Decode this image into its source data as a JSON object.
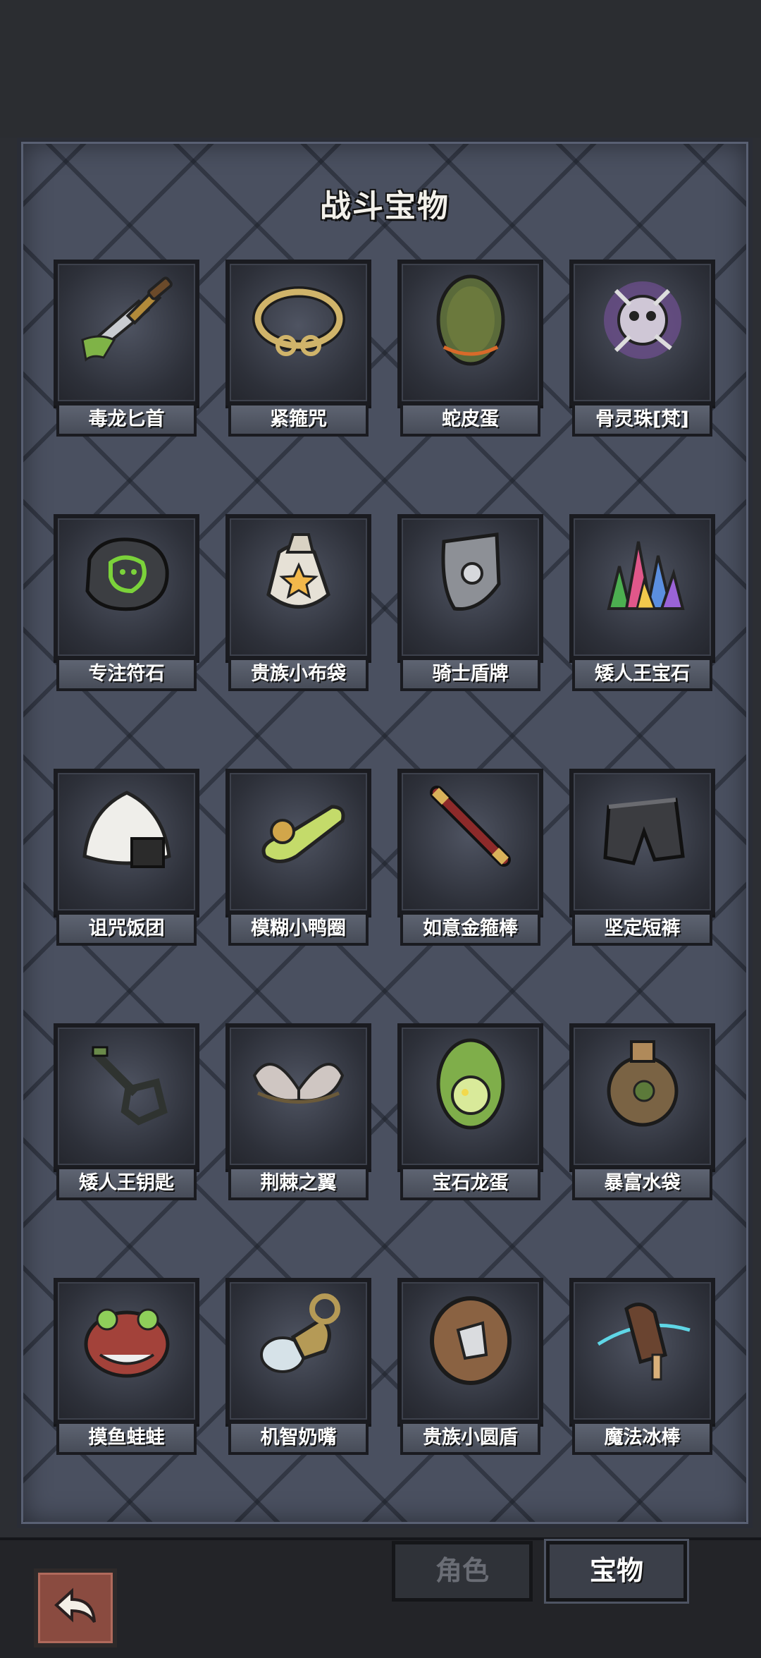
{
  "title": "战斗宝物",
  "items": [
    {
      "label": "毒龙匕首",
      "icon": "poison-dagger-icon"
    },
    {
      "label": "紧箍咒",
      "icon": "golden-band-icon"
    },
    {
      "label": "蛇皮蛋",
      "icon": "snakeskin-egg-icon"
    },
    {
      "label": "骨灵珠[梵]",
      "icon": "bone-orb-icon"
    },
    {
      "label": "专注符石",
      "icon": "focus-rune-icon"
    },
    {
      "label": "贵族小布袋",
      "icon": "cloth-bag-icon"
    },
    {
      "label": "骑士盾牌",
      "icon": "knight-shield-icon"
    },
    {
      "label": "矮人王宝石",
      "icon": "dwarf-gems-icon"
    },
    {
      "label": "诅咒饭团",
      "icon": "rice-ball-icon"
    },
    {
      "label": "模糊小鸭圈",
      "icon": "duck-ring-icon"
    },
    {
      "label": "如意金箍棒",
      "icon": "staff-icon"
    },
    {
      "label": "坚定短裤",
      "icon": "shorts-icon"
    },
    {
      "label": "矮人王钥匙",
      "icon": "key-icon"
    },
    {
      "label": "荆棘之翼",
      "icon": "thorn-wings-icon"
    },
    {
      "label": "宝石龙蛋",
      "icon": "dragon-egg-icon"
    },
    {
      "label": "暴富水袋",
      "icon": "water-flask-icon"
    },
    {
      "label": "摸鱼蛙蛙",
      "icon": "frog-icon"
    },
    {
      "label": "机智奶嘴",
      "icon": "pacifier-icon"
    },
    {
      "label": "贵族小圆盾",
      "icon": "round-shield-icon"
    },
    {
      "label": "魔法冰棒",
      "icon": "ice-pop-icon"
    },
    {
      "label": "",
      "icon": "fire-lotus-icon"
    },
    {
      "label": "",
      "icon": "sausage-dog-icon"
    },
    {
      "label": "",
      "icon": "curved-knife-icon"
    },
    {
      "label": "",
      "icon": "coffee-cup-icon"
    }
  ],
  "tabs": {
    "role": "角色",
    "treasure": "宝物"
  },
  "colors": {
    "panel": "#4a5060",
    "card": "#2d3039",
    "gold": "#c9a24a",
    "green": "#7bd23a"
  }
}
